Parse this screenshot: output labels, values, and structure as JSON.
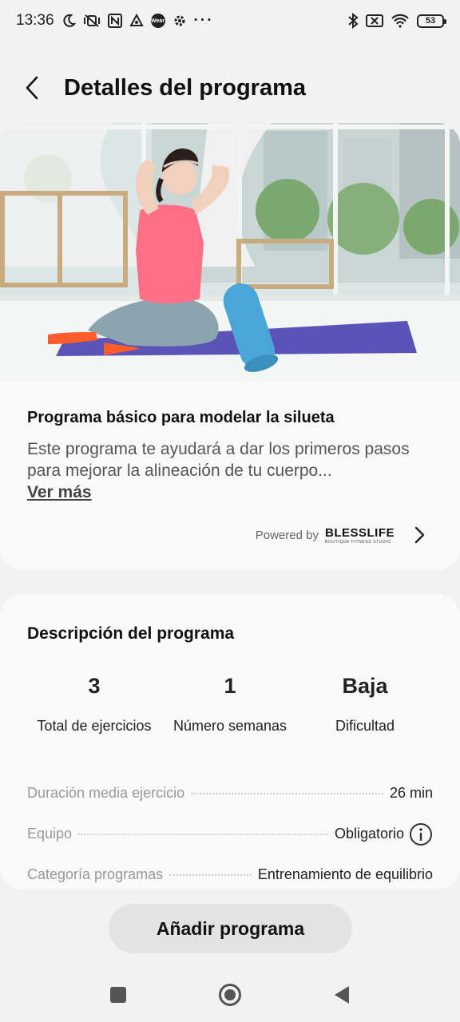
{
  "status_bar": {
    "time": "13:36",
    "left_icons": [
      "moon-icon",
      "mute-vibrate-icon",
      "nfc-icon",
      "drive-icon",
      "wear-icon",
      "gear-icon",
      "more-dots-icon"
    ],
    "wear_label": "Wear",
    "more": "···",
    "right_icons": [
      "bluetooth-icon",
      "no-sim-icon",
      "wifi-icon",
      "battery-icon"
    ],
    "battery": "53"
  },
  "header": {
    "title": "Detalles del programa"
  },
  "program": {
    "title": "Programa básico para modelar la silueta",
    "description": "Este programa te ayudará a dar los primeros pasos para mejorar la alineación de tu cuerpo...",
    "see_more": "Ver más",
    "powered_by": "Powered by",
    "brand": "BLESSLIFE",
    "brand_sub": "BOUTIQUE FITNESS STUDIO"
  },
  "description": {
    "section_title": "Descripción del programa",
    "stats": [
      {
        "value": "3",
        "label": "Total de ejercicios"
      },
      {
        "value": "1",
        "label": "Número semanas"
      },
      {
        "value": "Baja",
        "label": "Dificultad"
      }
    ],
    "rows": [
      {
        "label": "Duración media ejercicio",
        "value": "26 min"
      },
      {
        "label": "Equipo",
        "value": "Obligatorio"
      },
      {
        "label": "Categoría programas",
        "value": "Entrenamiento de equilibrio"
      }
    ]
  },
  "actions": {
    "add_program": "Añadir programa"
  },
  "colors": {
    "background": "#f2f2f2",
    "card": "#fafafa",
    "button": "#e3e3e3",
    "shirt": "#ff6f86",
    "mat": "#5b54b8",
    "roller": "#4aa6d6"
  }
}
